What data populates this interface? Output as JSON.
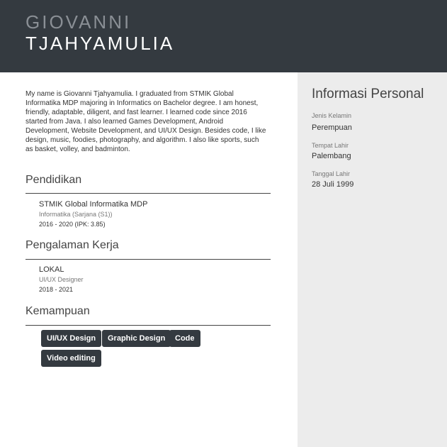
{
  "header": {
    "first_name": "GIOVANNI",
    "last_name": "TJAHYAMULIA"
  },
  "about": "My name is Giovanni Tjahyamulia. I graduated from STMIK Global Informatika MDP majoring in Informatics on Bachelor degree. I am honest, friendly, adaptable, diligent, and fast learner. I learned code since 2016 started from Java. I also learned Games Development, Android Development, Website Development, and UI/UX Design. Besides code, I like design, music, foodies, photography, and algorithm. I also like sports, such as basket, volley, and badminton.",
  "education": {
    "title": "Pendidikan",
    "items": [
      {
        "school": "STMIK Global Informatika MDP",
        "major": "Informatika (Sarjana (S1))",
        "period": "2016 - 2020 (IPK: 3.85)"
      }
    ]
  },
  "experience": {
    "title": "Pengalaman Kerja",
    "items": [
      {
        "company": "LOKAL",
        "role": "UI/UX Designer",
        "period": "2018 - 2021"
      }
    ]
  },
  "skills": {
    "title": "Kemampuan",
    "items": [
      "UI/UX Design",
      "Graphic Design",
      "Code",
      "Video editing"
    ]
  },
  "personal": {
    "title": "Informasi Personal",
    "fields": [
      {
        "label": "Jenis Kelamin",
        "value": "Perempuan"
      },
      {
        "label": "Tempat Lahir",
        "value": "Palembang"
      },
      {
        "label": "Tanggal Lahir",
        "value": "28 Juli 1999"
      }
    ]
  },
  "colors": {
    "header_bg": "#343a40",
    "sidebar_bg": "#ececec",
    "chip_bg": "#343a40"
  }
}
